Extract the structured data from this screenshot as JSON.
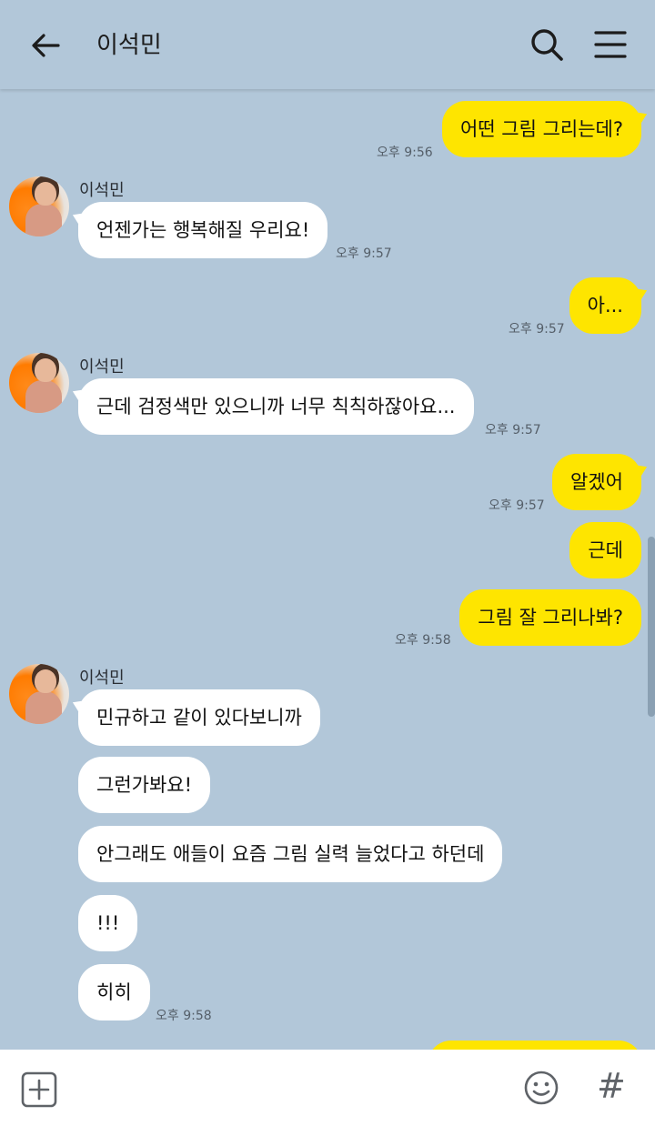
{
  "header": {
    "title": "이석민",
    "back_icon": "arrow-left-icon",
    "search_icon": "search-icon",
    "menu_icon": "hamburger-menu-icon"
  },
  "colors": {
    "background": "#b2c7d9",
    "my_bubble": "#fee500",
    "their_bubble": "#ffffff"
  },
  "messages": [
    {
      "id": "m1",
      "from": "me",
      "text": "어떤 그림 그리는데?",
      "time": "오후 9:56"
    },
    {
      "id": "m2",
      "from": "이석민",
      "text": "언젠가는 행복해질 우리요!",
      "time": "오후 9:57"
    },
    {
      "id": "m3",
      "from": "me",
      "text": "아...",
      "time": "오후 9:57"
    },
    {
      "id": "m4",
      "from": "이석민",
      "text": "근데 검정색만 있으니까 너무 칙칙하잖아요...",
      "time": "오후 9:57"
    },
    {
      "id": "m5",
      "from": "me",
      "text": "알겠어",
      "time": "오후 9:57"
    },
    {
      "id": "m6",
      "from": "me",
      "text": "근데",
      "time": ""
    },
    {
      "id": "m7",
      "from": "me",
      "text": "그림 잘 그리나봐?",
      "time": "오후 9:58"
    },
    {
      "id": "m8",
      "from": "이석민",
      "text": "민규하고 같이 있다보니까",
      "time": ""
    },
    {
      "id": "m9",
      "from": "이석민",
      "text": "그런가봐요!",
      "time": ""
    },
    {
      "id": "m10",
      "from": "이석민",
      "text": "안그래도 애들이 요즘 그림 실력 늘었다고 하던데",
      "time": ""
    },
    {
      "id": "m11",
      "from": "이석민",
      "text": "!!!",
      "time": ""
    },
    {
      "id": "m12",
      "from": "이석민",
      "text": "히히",
      "time": "오후 9:58"
    }
  ],
  "sender_names": [
    "이석민",
    "이석민",
    "이석민"
  ],
  "footer": {
    "attach_icon": "plus-square-icon",
    "emoji_icon": "smiley-icon",
    "hash_icon": "hashtag-icon",
    "hash_glyph": "#"
  }
}
